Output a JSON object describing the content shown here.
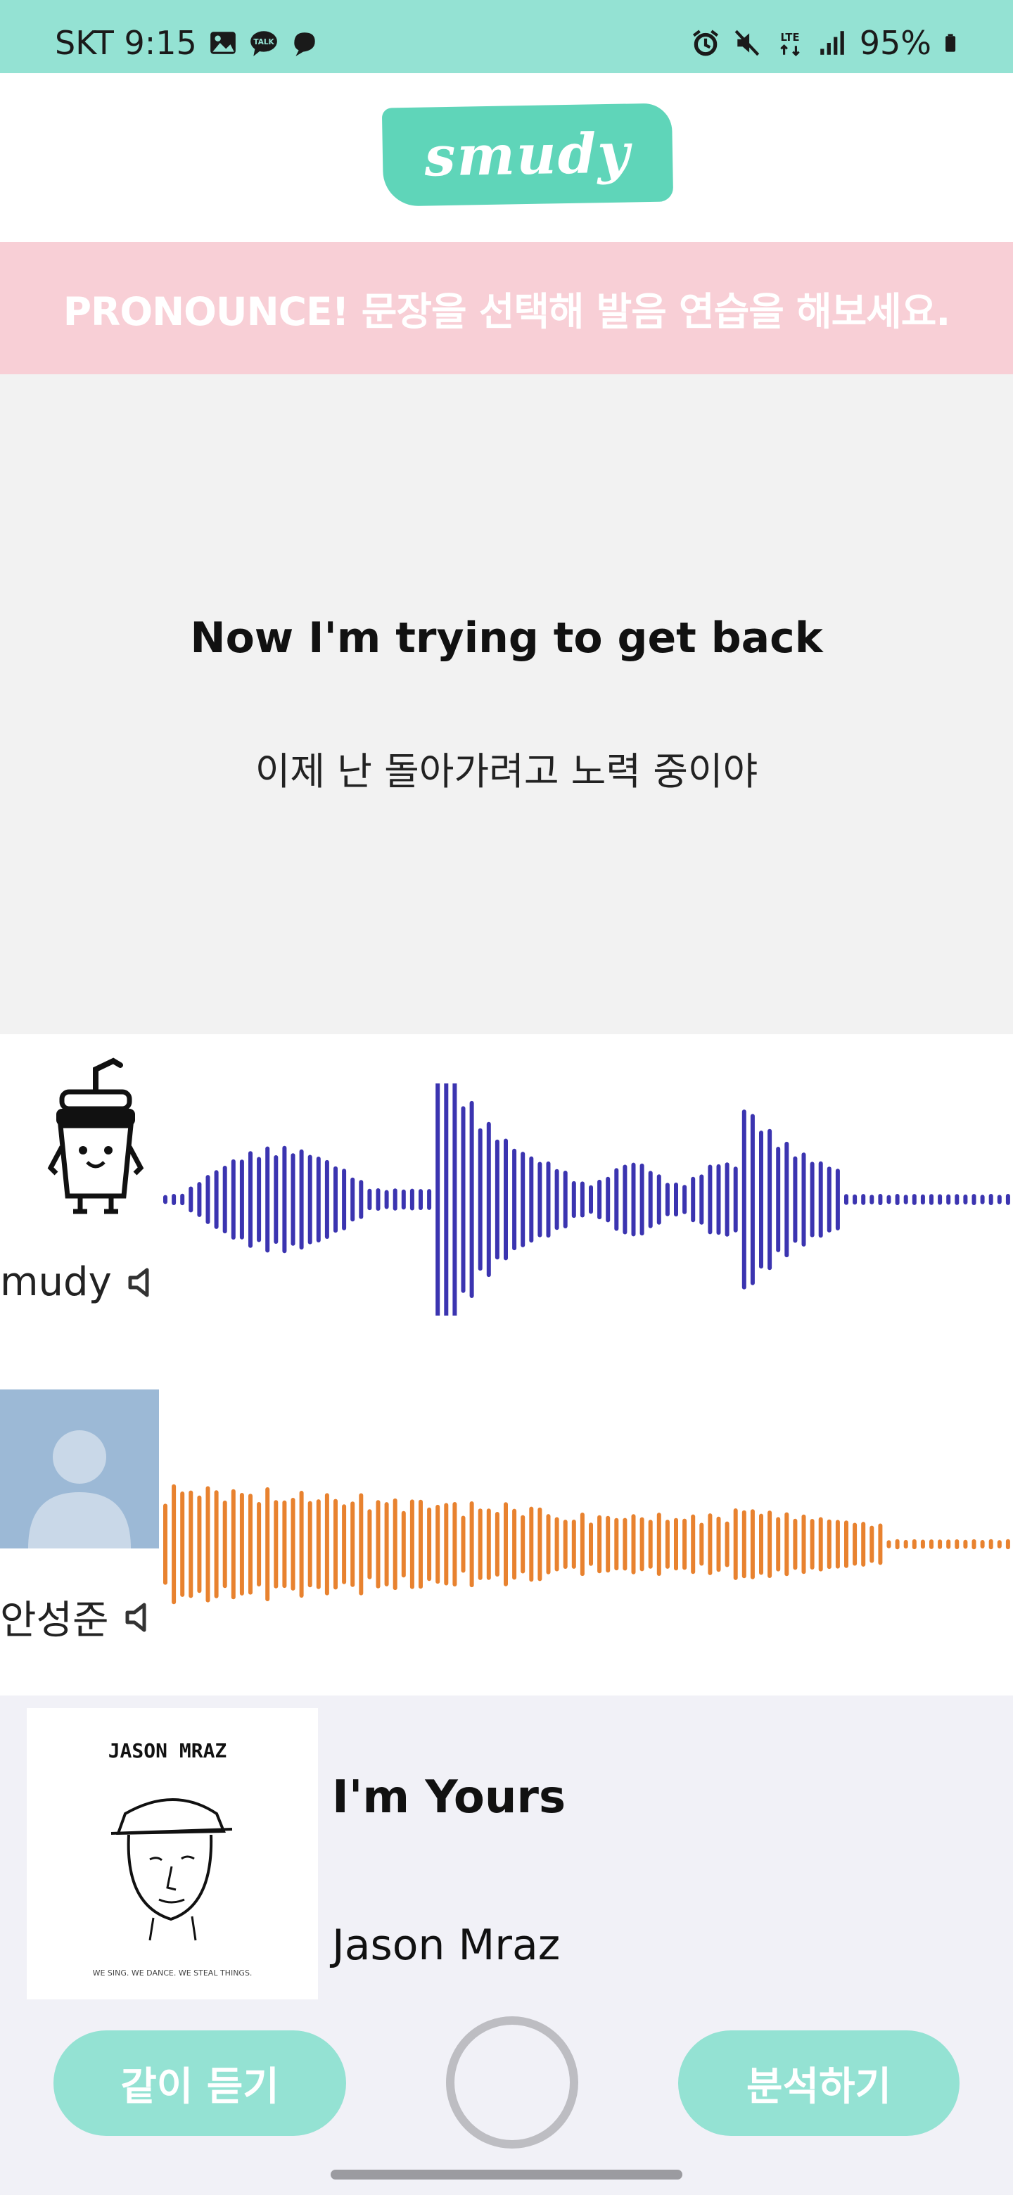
{
  "status_bar": {
    "carrier_time": "SKT 9:15",
    "battery": "95%",
    "network": "LTE",
    "icons": [
      "gallery-icon",
      "talk-icon",
      "chat-icon",
      "alarm-icon",
      "mute-icon",
      "signal-icon",
      "battery-icon"
    ]
  },
  "app": {
    "logo_text": "smudy",
    "brand_color": "#5fd5b9",
    "accent_color": "#94e2d3"
  },
  "banner": {
    "text": "PRONOUNCE! 문장을 선택해 발음 연습을 해보세요."
  },
  "sentence": {
    "english": "Now I'm trying to get back",
    "korean": "이제 난 돌아가려고 노력 중이야"
  },
  "recordings": [
    {
      "name": "mudy",
      "avatar": "cup-mascot-icon",
      "wave_color": "#3b34b0",
      "audio_icon": "speaker-icon"
    },
    {
      "name": "안성준",
      "avatar": "default-user-avatar",
      "wave_color": "#e8822f",
      "audio_icon": "speaker-icon"
    }
  ],
  "song": {
    "title": "I'm Yours",
    "artist": "Jason Mraz",
    "album_art_text": "JASON MRAZ",
    "album_art_caption": "WE SING. WE DANCE. WE STEAL THINGS."
  },
  "controls": {
    "listen_together": "같이 듣기",
    "analyze": "분석하기",
    "record_icon": "record-button-icon"
  }
}
